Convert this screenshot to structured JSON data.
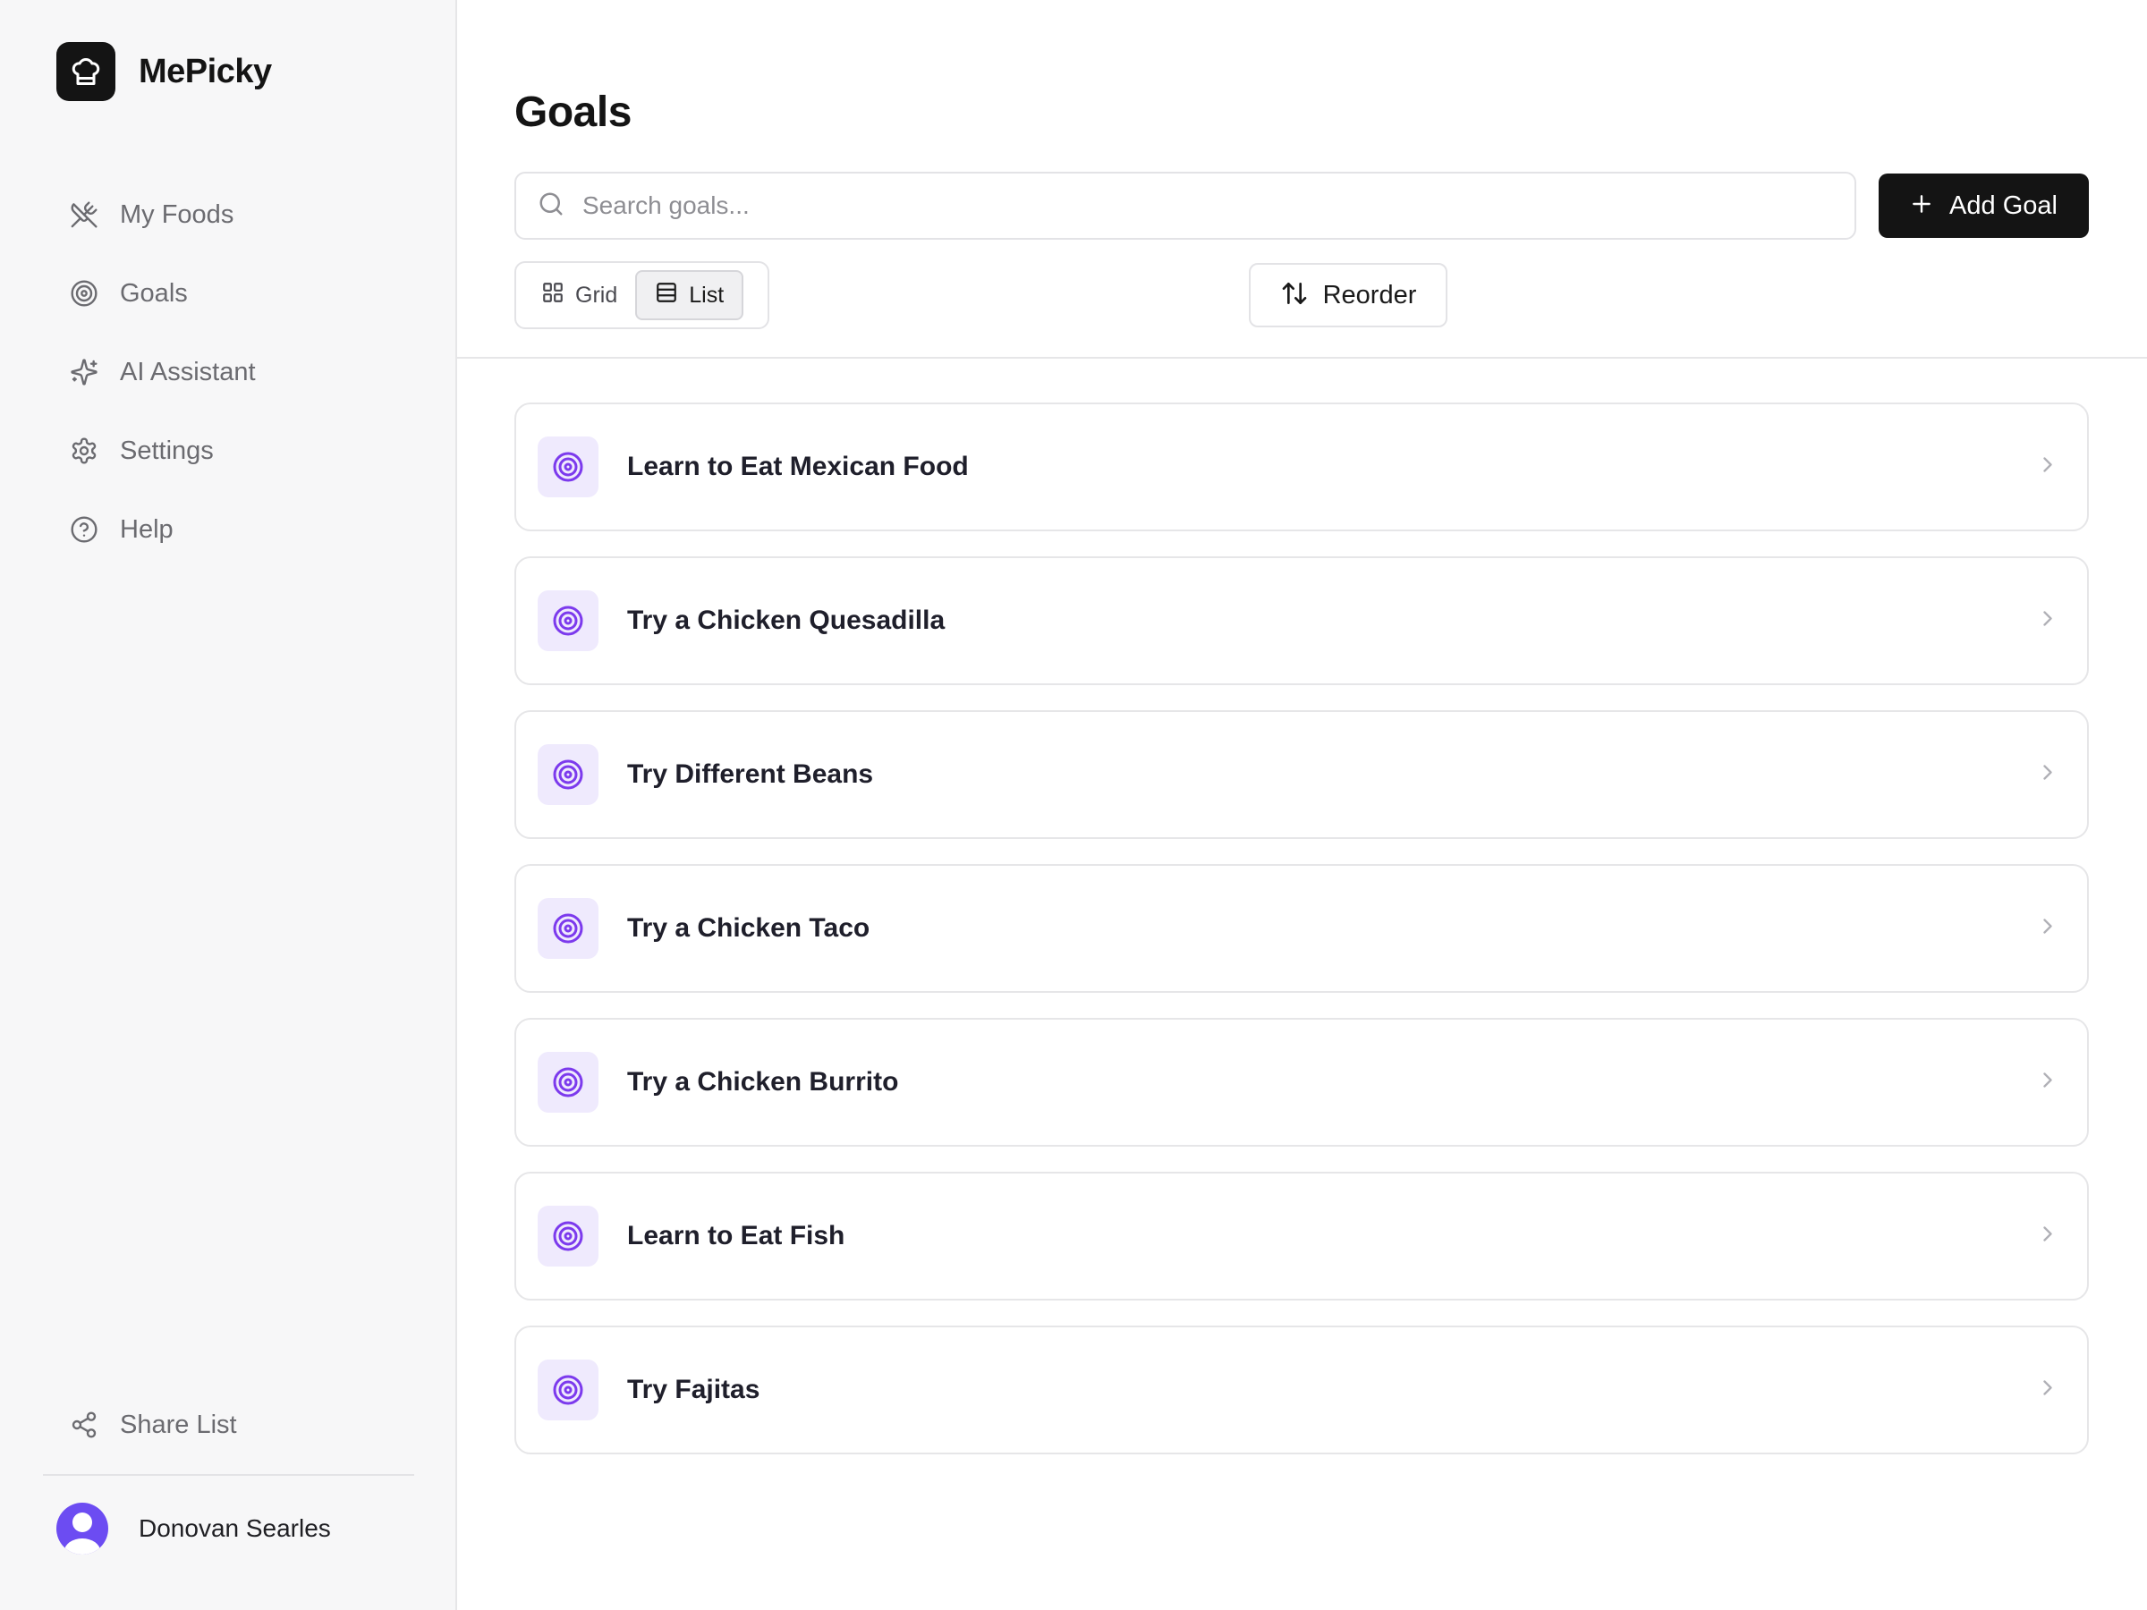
{
  "brand": {
    "name": "MePicky"
  },
  "sidebar": {
    "items": [
      {
        "label": "My Foods",
        "icon": "utensils-crossed-icon"
      },
      {
        "label": "Goals",
        "icon": "target-icon"
      },
      {
        "label": "AI Assistant",
        "icon": "sparkles-icon"
      },
      {
        "label": "Settings",
        "icon": "gear-icon"
      },
      {
        "label": "Help",
        "icon": "help-circle-icon"
      }
    ],
    "share": {
      "label": "Share List",
      "icon": "share-icon"
    },
    "user": {
      "name": "Donovan Searles"
    }
  },
  "main": {
    "title": "Goals",
    "search": {
      "placeholder": "Search goals...",
      "value": ""
    },
    "add_button": "Add Goal",
    "view_toggle": {
      "grid": "Grid",
      "list": "List",
      "selected": "List"
    },
    "reorder_button": "Reorder",
    "goals": [
      {
        "title": "Learn to Eat Mexican Food"
      },
      {
        "title": "Try a Chicken Quesadilla"
      },
      {
        "title": "Try Different Beans"
      },
      {
        "title": "Try a Chicken Taco"
      },
      {
        "title": "Try a Chicken Burrito"
      },
      {
        "title": "Learn to Eat Fish"
      },
      {
        "title": "Try Fajitas"
      }
    ]
  },
  "colors": {
    "accent": "#7c3aed",
    "goal_icon_bg": "#efeafd",
    "primary_button": "#141414"
  }
}
